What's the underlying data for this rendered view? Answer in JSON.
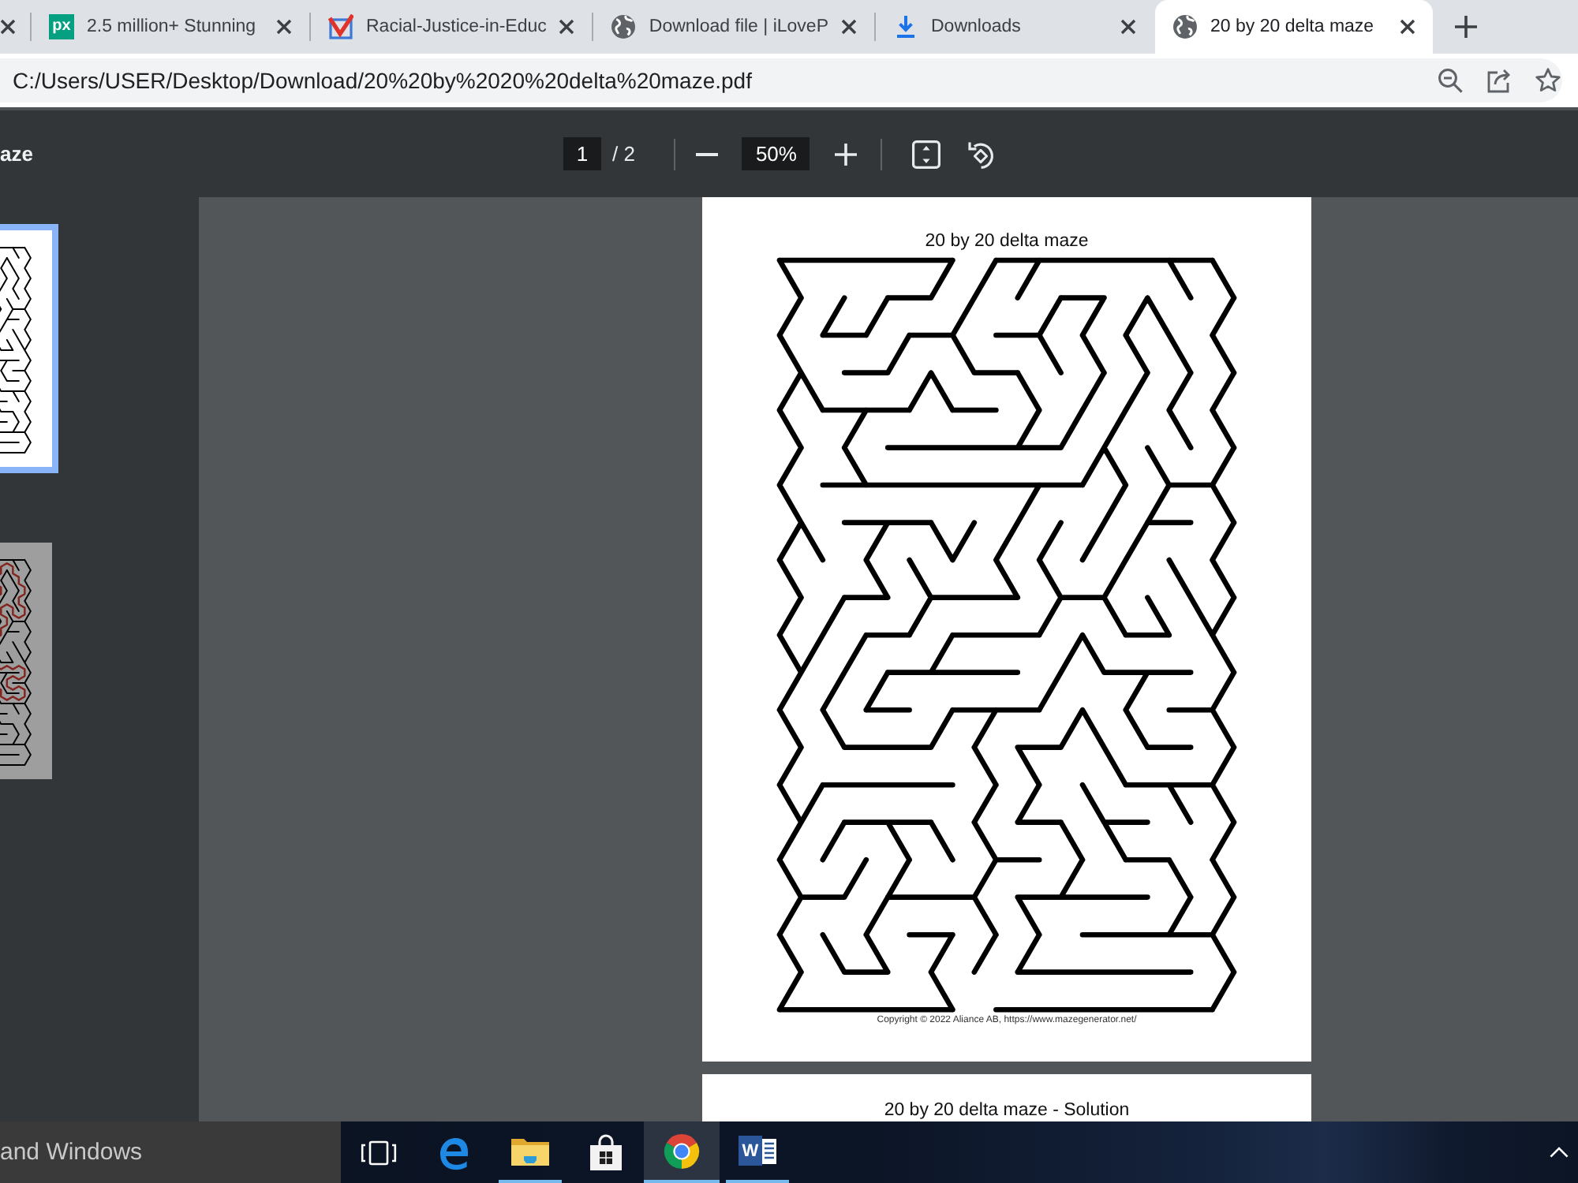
{
  "tabs": [
    {
      "selected": false
    },
    {
      "kind": "logo",
      "logo_text": "px",
      "title": "2.5 million+ Stunning",
      "selected": false
    },
    {
      "kind": "mark",
      "title": "Racial-Justice-in-Educ",
      "selected": false
    },
    {
      "kind": "globe",
      "title": "Download file | iLoveP",
      "selected": false
    },
    {
      "kind": "download",
      "title": "Downloads",
      "selected": false
    },
    {
      "kind": "globe",
      "title": "20 by 20 delta maze",
      "selected": true
    }
  ],
  "address_bar": {
    "url": "C:/Users/USER/Desktop/Download/20%20by%2020%20delta%20maze.pdf"
  },
  "pdf_toolbar": {
    "title": "aze",
    "page_input": "1",
    "page_total": "/ 2",
    "zoom": "50%"
  },
  "sidebar": {
    "thumbnails": [
      {
        "kind": "maze",
        "selected": true
      },
      {
        "kind": "solution",
        "selected": false
      }
    ]
  },
  "pages": [
    {
      "kind": "maze",
      "title": "20 by 20 delta maze",
      "footer": "Copyright © 2022 Aliance AB, https://www.mazegenerator.net/"
    },
    {
      "title": "20 by 20 delta maze - Solution"
    }
  ],
  "taskbar": {
    "search": {
      "placeholder": "and Windows"
    },
    "apps": [
      {
        "kind": "task-view",
        "running": false,
        "selected": false
      },
      {
        "kind": "edge",
        "running": false,
        "selected": false
      },
      {
        "kind": "explorer",
        "running": true,
        "selected": false
      },
      {
        "kind": "store",
        "running": false,
        "selected": false
      },
      {
        "kind": "chrome",
        "running": true,
        "selected": true
      },
      {
        "kind": "word",
        "logo_text": "W",
        "running": true,
        "selected": false
      }
    ]
  }
}
